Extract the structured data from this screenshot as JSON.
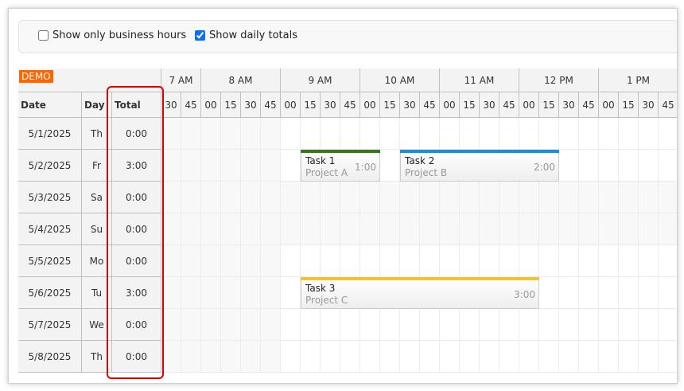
{
  "toolbar": {
    "business_hours_label": "Show only business hours",
    "business_hours_checked": false,
    "daily_totals_label": "Show daily totals",
    "daily_totals_checked": true
  },
  "grid": {
    "demo_badge": "DEMO",
    "columns": {
      "date": "Date",
      "day": "Day",
      "total": "Total"
    },
    "hours": [
      {
        "label": "7 AM",
        "minutes": [
          "30",
          "45"
        ]
      },
      {
        "label": "8 AM",
        "minutes": [
          "00",
          "15",
          "30",
          "45"
        ]
      },
      {
        "label": "9 AM",
        "minutes": [
          "00",
          "15",
          "30",
          "45"
        ]
      },
      {
        "label": "10 AM",
        "minutes": [
          "00",
          "15",
          "30",
          "45"
        ]
      },
      {
        "label": "11 AM",
        "minutes": [
          "00",
          "15",
          "30",
          "45"
        ]
      },
      {
        "label": "12 PM",
        "minutes": [
          "00",
          "15",
          "30",
          "45"
        ]
      },
      {
        "label": "1 PM",
        "minutes": [
          "00",
          "15",
          "30",
          "45"
        ]
      }
    ],
    "rows": [
      {
        "date": "5/1/2025",
        "day": "Th",
        "total": "0:00",
        "weekend": false
      },
      {
        "date": "5/2/2025",
        "day": "Fr",
        "total": "3:00",
        "weekend": false
      },
      {
        "date": "5/3/2025",
        "day": "Sa",
        "total": "0:00",
        "weekend": true
      },
      {
        "date": "5/4/2025",
        "day": "Su",
        "total": "0:00",
        "weekend": true
      },
      {
        "date": "5/5/2025",
        "day": "Mo",
        "total": "0:00",
        "weekend": false
      },
      {
        "date": "5/6/2025",
        "day": "Tu",
        "total": "3:00",
        "weekend": false
      },
      {
        "date": "5/7/2025",
        "day": "We",
        "total": "0:00",
        "weekend": false
      },
      {
        "date": "5/8/2025",
        "day": "Th",
        "total": "0:00",
        "weekend": false
      }
    ],
    "tasks": [
      {
        "name": "Task 1",
        "project": "Project A",
        "duration": "1:00",
        "row": 1,
        "start": "9:15",
        "end": "10:15",
        "color": "#38761d"
      },
      {
        "name": "Task 2",
        "project": "Project B",
        "duration": "2:00",
        "row": 1,
        "start": "10:30",
        "end": "12:30",
        "color": "#1a8fd6"
      },
      {
        "name": "Task 3",
        "project": "Project C",
        "duration": "3:00",
        "row": 5,
        "start": "9:15",
        "end": "12:15",
        "color": "#f1c232"
      }
    ],
    "highlight_color": "#e00000"
  }
}
